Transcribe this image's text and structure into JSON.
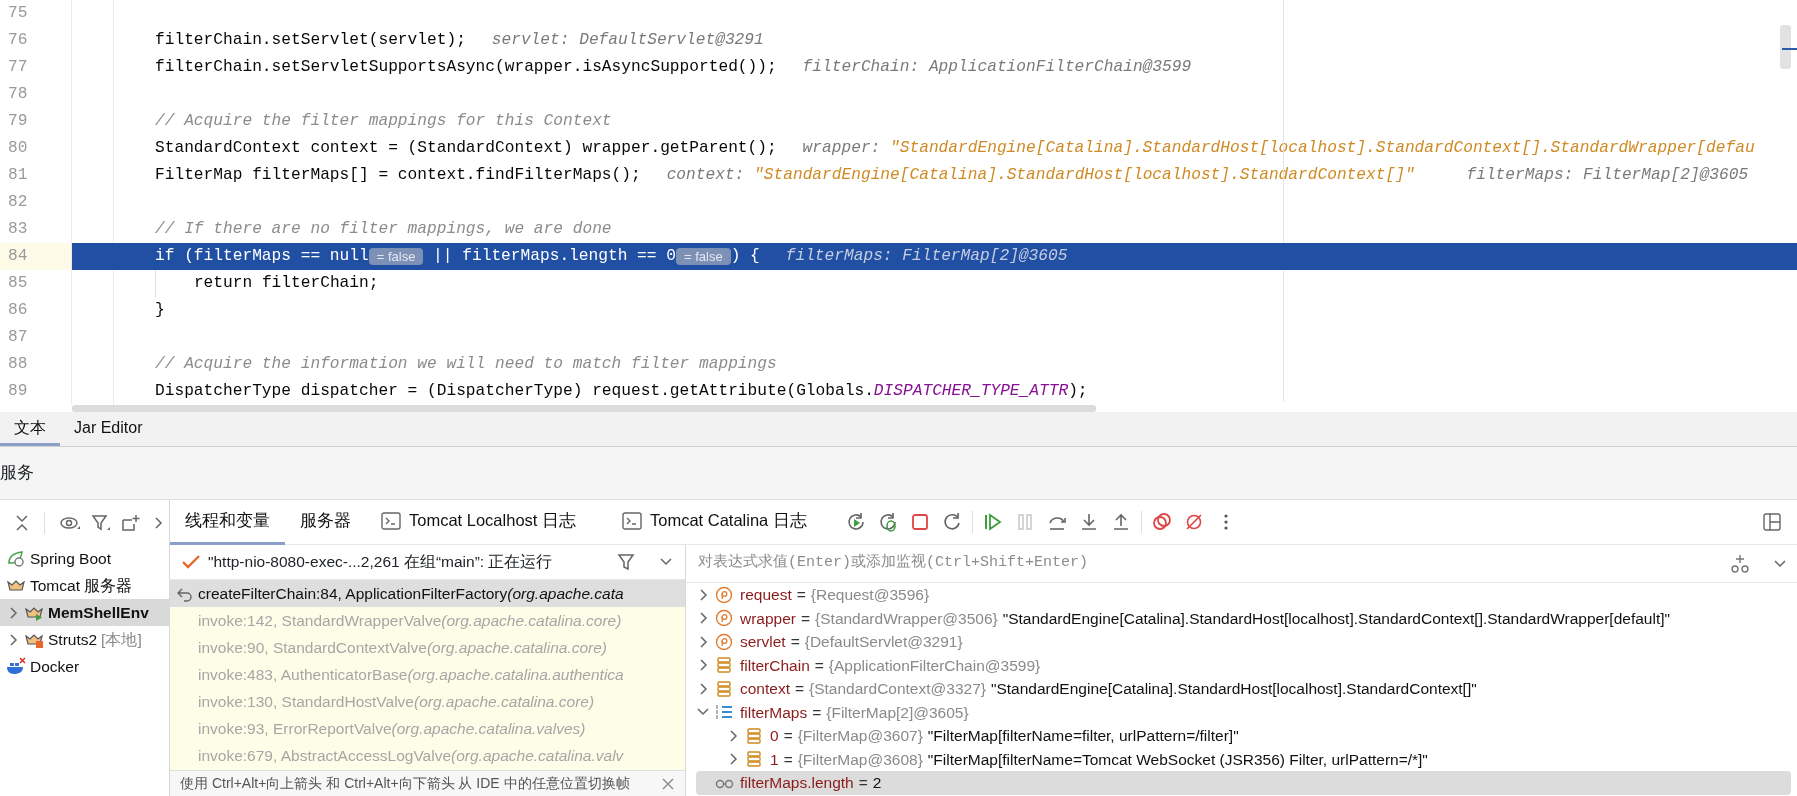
{
  "editor": {
    "lines": [
      {
        "number": "75",
        "current": false
      },
      {
        "number": "76",
        "current": false,
        "segments": [
          {
            "kind": "code",
            "text": "filterChain.setServlet(servlet);"
          },
          {
            "kind": "hint",
            "text": "servlet: DefaultServlet@3291"
          }
        ]
      },
      {
        "number": "77",
        "current": false,
        "segments": [
          {
            "kind": "code",
            "text": "filterChain.setServletSupportsAsync(wrapper.isAsyncSupported());"
          },
          {
            "kind": "hint",
            "text": "filterChain: ApplicationFilterChain@3599"
          }
        ]
      },
      {
        "number": "78",
        "current": false
      },
      {
        "number": "79",
        "current": false,
        "segments": [
          {
            "kind": "comment",
            "text": "// Acquire the filter mappings for this Context"
          }
        ]
      },
      {
        "number": "80",
        "current": false,
        "segments": [
          {
            "kind": "code",
            "text": "StandardContext context = (StandardContext) wrapper.getParent();"
          },
          {
            "kind": "hint",
            "text": "wrapper:"
          },
          {
            "kind": "string",
            "text": "\"StandardEngine[Catalina].StandardHost[localhost].StandardContext[].StandardWrapper[defau"
          }
        ]
      },
      {
        "number": "81",
        "current": false,
        "segments": [
          {
            "kind": "code",
            "text": "FilterMap filterMaps[] = context.findFilterMaps();"
          },
          {
            "kind": "hint",
            "text": "context:"
          },
          {
            "kind": "string",
            "text": "\"StandardEngine[Catalina].StandardHost[localhost].StandardContext[]\""
          },
          {
            "kind": "hint2",
            "text": "filterMaps: FilterMap[2]@3605"
          }
        ]
      },
      {
        "number": "82",
        "current": false
      },
      {
        "number": "83",
        "current": false,
        "segments": [
          {
            "kind": "comment",
            "text": "// If there are no filter mappings, we are done"
          }
        ]
      },
      {
        "number": "84",
        "current": true,
        "segments": [
          {
            "kind": "code",
            "text": "if (filterMaps == null"
          },
          {
            "kind": "value",
            "text": "= false"
          },
          {
            "kind": "code",
            "text": " || filterMaps.length == 0"
          },
          {
            "kind": "value",
            "text": "= false"
          },
          {
            "kind": "code",
            "text": ") {"
          },
          {
            "kind": "hint",
            "text": "filterMaps: FilterMap[2]@3605"
          }
        ],
        "children": [
          {
            "number": "85",
            "current": false,
            "segments": [
              {
                "kind": "code",
                "text": "return filterChain;"
              }
            ]
          }
        ]
      },
      {
        "number": "86",
        "current": false,
        "segments": [
          {
            "kind": "code",
            "text": "}"
          }
        ]
      },
      {
        "number": "87",
        "current": false
      },
      {
        "number": "88",
        "current": false,
        "segments": [
          {
            "kind": "comment",
            "text": "// Acquire the information we will need to match filter mappings"
          }
        ]
      },
      {
        "number": "89",
        "current": false,
        "segments": [
          {
            "kind": "code",
            "text": "DispatcherType dispatcher = (DispatcherType) request.getAttribute(Globals."
          },
          {
            "kind": "const",
            "text": "DISPATCHER_TYPE_ATTR"
          },
          {
            "kind": "code",
            "text": ");"
          }
        ]
      }
    ]
  },
  "editor_tabs": [
    {
      "label": "文本",
      "selected": true
    },
    {
      "label": "Jar Editor",
      "selected": false
    }
  ],
  "tool_window": {
    "title": "服务"
  },
  "services": [
    {
      "label": "Spring Boot",
      "kind": "spring",
      "selected": false
    },
    {
      "label": "Tomcat 服务器",
      "kind": "tomcat",
      "selected": false,
      "children": [
        {
          "label": "MemShellEnv",
          "kind": "tomcat_running",
          "selected": true,
          "expanded": false
        },
        {
          "label": "Struts2",
          "note": "[本地]",
          "kind": "tomcat_stopped",
          "selected": false,
          "expanded": false
        }
      ]
    },
    {
      "label": "Docker",
      "kind": "docker",
      "selected": false
    }
  ],
  "debug_tabs": [
    {
      "label": "线程和变量",
      "kind": "plain",
      "selected": true
    },
    {
      "label": "服务器",
      "kind": "plain",
      "selected": false
    },
    {
      "label": "Tomcat Localhost 日志",
      "kind": "console",
      "selected": false
    },
    {
      "label": "Tomcat Catalina 日志",
      "kind": "console",
      "selected": false
    }
  ],
  "debug_toolbar": [
    {
      "kind": "rerun",
      "disabled": false
    },
    {
      "kind": "rerun_debug",
      "disabled": false
    },
    {
      "kind": "stop",
      "disabled": false
    },
    {
      "kind": "restart",
      "disabled": false
    },
    {
      "kind": "separator"
    },
    {
      "kind": "resume",
      "disabled": false
    },
    {
      "kind": "pause",
      "disabled": true
    },
    {
      "kind": "step_over",
      "disabled": false
    },
    {
      "kind": "step_into",
      "disabled": false
    },
    {
      "kind": "step_out",
      "disabled": false
    },
    {
      "kind": "separator"
    },
    {
      "kind": "breakpoints",
      "disabled": false
    },
    {
      "kind": "mute",
      "disabled": false
    },
    {
      "kind": "more",
      "disabled": false
    }
  ],
  "thread": {
    "label": "\"http-nio-8080-exec-...2,261 在组“main”: 正在运行"
  },
  "frames": [
    {
      "method": "createFilterChain:84, ApplicationFilterFactory",
      "package": "(org.apache.cata",
      "selected": true
    },
    {
      "method": "invoke:142, StandardWrapperValve",
      "package": "(org.apache.catalina.core)",
      "selected": false
    },
    {
      "method": "invoke:90, StandardContextValve",
      "package": "(org.apache.catalina.core)",
      "selected": false
    },
    {
      "method": "invoke:483, AuthenticatorBase",
      "package": "(org.apache.catalina.authentica",
      "selected": false
    },
    {
      "method": "invoke:130, StandardHostValve",
      "package": "(org.apache.catalina.core)",
      "selected": false
    },
    {
      "method": "invoke:93, ErrorReportValve",
      "package": "(org.apache.catalina.valves)",
      "selected": false
    },
    {
      "method": "invoke:679, AbstractAccessLogValve",
      "package": "(org.apache.catalina.valv",
      "selected": false
    }
  ],
  "frames_hint": "使用 Ctrl+Alt+向上箭头 和 Ctrl+Alt+向下箭头 从 IDE 中的任意位置切换帧",
  "evaluate": {
    "placeholder": "对表达式求值(Enter)或添加监视(Ctrl+Shift+Enter)"
  },
  "variables": [
    {
      "kind": "param",
      "name": "request",
      "operator": "=",
      "type": "{Request@3596}",
      "expanded": false,
      "selected": false
    },
    {
      "kind": "param",
      "name": "wrapper",
      "operator": "=",
      "type": "{StandardWrapper@3506}",
      "value": "\"StandardEngine[Catalina].StandardHost[localhost].StandardContext[].StandardWrapper[default]\"",
      "expanded": false,
      "selected": false
    },
    {
      "kind": "param",
      "name": "servlet",
      "operator": "=",
      "type": "{DefaultServlet@3291}",
      "expanded": false,
      "selected": false
    },
    {
      "kind": "local",
      "name": "filterChain",
      "operator": "=",
      "type": "{ApplicationFilterChain@3599}",
      "expanded": false,
      "selected": false
    },
    {
      "kind": "local",
      "name": "context",
      "operator": "=",
      "type": "{StandardContext@3327}",
      "value": "\"StandardEngine[Catalina].StandardHost[localhost].StandardContext[]\"",
      "expanded": false,
      "selected": false
    },
    {
      "kind": "array",
      "name": "filterMaps",
      "operator": "=",
      "type": "{FilterMap[2]@3605}",
      "expanded": true,
      "selected": false,
      "children": [
        {
          "kind": "local",
          "name": "0",
          "operator": "=",
          "type": "{FilterMap@3607}",
          "value": "\"FilterMap[filterName=filter, urlPattern=/filter]\"",
          "expanded": false,
          "selected": false
        },
        {
          "kind": "local",
          "name": "1",
          "operator": "=",
          "type": "{FilterMap@3608}",
          "value": "\"FilterMap[filterName=Tomcat WebSocket (JSR356) Filter, urlPattern=/*]\"",
          "expanded": false,
          "selected": false
        }
      ]
    },
    {
      "kind": "watch",
      "name": "filterMaps.length",
      "operator": "=",
      "value": "2",
      "selected": true
    }
  ]
}
